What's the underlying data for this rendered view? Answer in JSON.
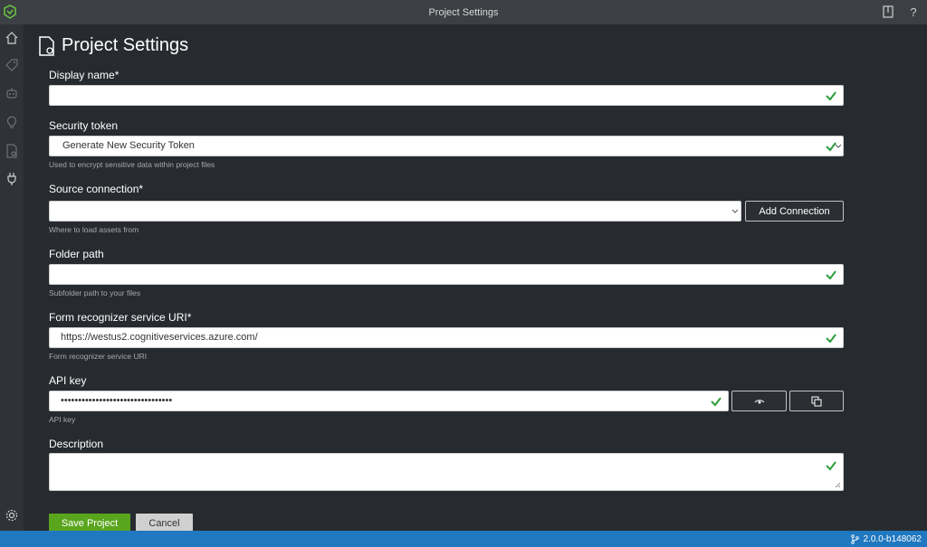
{
  "window": {
    "title": "Project Settings"
  },
  "page": {
    "title": "Project Settings"
  },
  "fields": {
    "display_name": {
      "label": "Display name*",
      "value": ""
    },
    "security_token": {
      "label": "Security token",
      "value": "Generate New Security Token",
      "help": "Used to encrypt sensitive data within project files"
    },
    "source_connection": {
      "label": "Source connection*",
      "value": "",
      "help": "Where to load assets from",
      "add_label": "Add Connection"
    },
    "folder_path": {
      "label": "Folder path",
      "value": "",
      "help": "Subfolder path to your files"
    },
    "service_uri": {
      "label": "Form recognizer service URI*",
      "value": "https://westus2.cognitiveservices.azure.com/",
      "help": "Form recognizer service URI"
    },
    "api_key": {
      "label": "API key",
      "value": "••••••••••••••••••••••••••••••••",
      "help": "API key"
    },
    "description": {
      "label": "Description",
      "value": ""
    }
  },
  "actions": {
    "save_label": "Save Project",
    "cancel_label": "Cancel"
  },
  "status": {
    "version": "2.0.0-b148062"
  },
  "icons": {
    "sidebar": [
      "home-icon",
      "tag-icon",
      "robot-icon",
      "lightbulb-icon",
      "document-settings-icon",
      "plug-icon",
      "gear-icon"
    ],
    "titlebar": [
      "book-icon",
      "help-icon"
    ]
  },
  "colors": {
    "accent_green": "#5aa51e",
    "check_green": "#2a9d3a",
    "status_blue": "#1f78c0"
  }
}
